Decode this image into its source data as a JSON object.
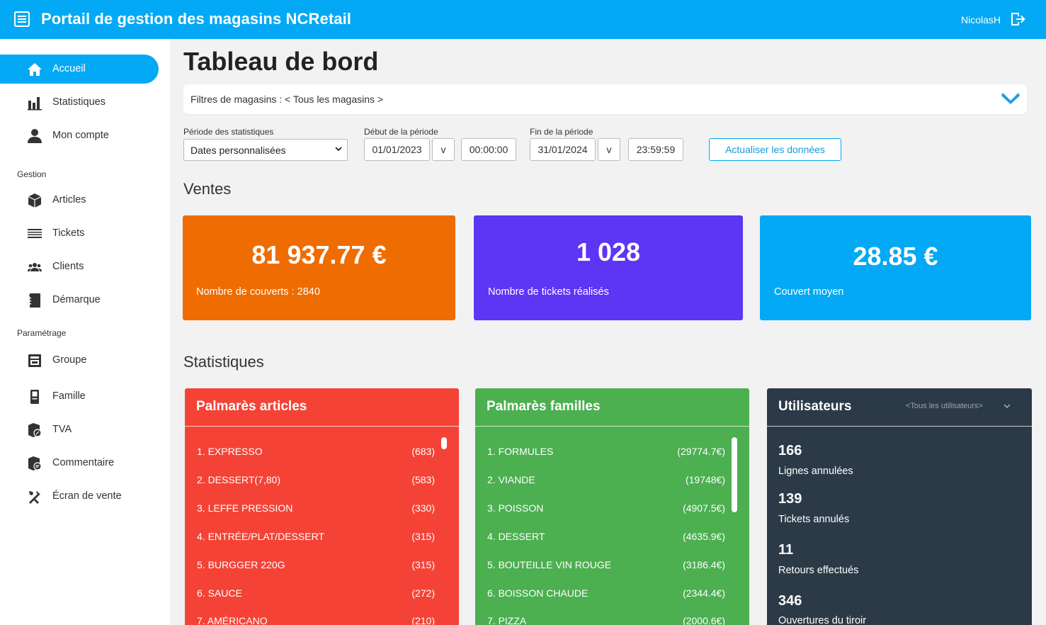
{
  "header": {
    "title": "Portail de gestion des magasins NCRetail",
    "username": "NicolasH",
    "menu_icon": "menu-icon",
    "logout_icon": "logout-icon",
    "color": "#03a9f4"
  },
  "sidebar": {
    "items_top": [
      {
        "label": "Accueil",
        "icon": "home-icon",
        "active": true
      },
      {
        "label": "Statistiques",
        "icon": "bar-chart-icon"
      },
      {
        "label": "Mon compte",
        "icon": "user-icon"
      }
    ],
    "section_gestion": "Gestion",
    "items_gestion": [
      {
        "label": "Articles",
        "icon": "cube-icon"
      },
      {
        "label": "Tickets",
        "icon": "list-icon"
      },
      {
        "label": "Clients",
        "icon": "users-icon"
      },
      {
        "label": "Démarque",
        "icon": "book-icon"
      }
    ],
    "section_parametrage": "Paramétrage",
    "items_parametrage": [
      {
        "label": "Groupe",
        "icon": "group-icon"
      },
      {
        "label": "Famille",
        "icon": "family-icon"
      },
      {
        "label": "TVA",
        "icon": "tax-icon"
      },
      {
        "label": "Commentaire",
        "icon": "comment-icon"
      },
      {
        "label": "Écran de vente",
        "icon": "tools-icon"
      }
    ]
  },
  "main": {
    "title": "Tableau de bord",
    "store_filter": "Filtres de magasins : < Tous les magasins >",
    "period": {
      "label": "Période des statistiques",
      "selected": "Dates personnalisées"
    },
    "start": {
      "label": "Début de la période",
      "date": "01/01/2023",
      "toggle": "v",
      "time": "00:00:00"
    },
    "end": {
      "label": "Fin de la période",
      "date": "31/01/2024",
      "toggle": "v",
      "time": "23:59:59"
    },
    "refresh_label": "Actualiser les données"
  },
  "ventes": {
    "title": "Ventes",
    "cards": [
      {
        "value": "81 937.77 €",
        "caption": "Nombre de couverts : 2840",
        "color": "#ef6c00"
      },
      {
        "value": "1 028",
        "caption": "Nombre de tickets réalisés",
        "color": "#5c35f5"
      },
      {
        "value": "28.85 €",
        "caption": "Couvert moyen",
        "color": "#03a9f4"
      }
    ]
  },
  "statistiques": {
    "title": "Statistiques",
    "articles": {
      "title": "Palmarès articles",
      "color": "#f44336",
      "rows": [
        {
          "name": "1. EXPRESSO",
          "value": "(683)"
        },
        {
          "name": "2. DESSERT(7,80)",
          "value": "(583)"
        },
        {
          "name": "3. LEFFE PRESSION",
          "value": "(330)"
        },
        {
          "name": "4. ENTRÉE/PLAT/DESSERT",
          "value": "(315)"
        },
        {
          "name": "5. BURGGER 220G",
          "value": "(315)"
        },
        {
          "name": "6. SAUCE",
          "value": "(272)"
        },
        {
          "name": "7. AMÉRICANO",
          "value": "(210)"
        }
      ]
    },
    "familles": {
      "title": "Palmarès familles",
      "color": "#4caf50",
      "rows": [
        {
          "name": "1. FORMULES",
          "value": "(29774.7€)"
        },
        {
          "name": "2. VIANDE",
          "value": "(19748€)"
        },
        {
          "name": "3. POISSON",
          "value": "(4907.5€)"
        },
        {
          "name": "4. DESSERT",
          "value": "(4635.9€)"
        },
        {
          "name": "5. BOUTEILLE VIN ROUGE",
          "value": "(3186.4€)"
        },
        {
          "name": "6. BOISSON CHAUDE",
          "value": "(2344.4€)"
        },
        {
          "name": "7. PIZZA",
          "value": "(2000.6€)"
        }
      ]
    },
    "utilisateurs": {
      "title": "Utilisateurs",
      "filter": "<Tous les utilisateurs>",
      "color": "#2c3a47",
      "stats": [
        {
          "value": "166",
          "label": "Lignes annulées"
        },
        {
          "value": "139",
          "label": "Tickets annulés"
        },
        {
          "value": "11",
          "label": "Retours effectués"
        },
        {
          "value": "346",
          "label": "Ouvertures du tiroir"
        }
      ]
    }
  }
}
